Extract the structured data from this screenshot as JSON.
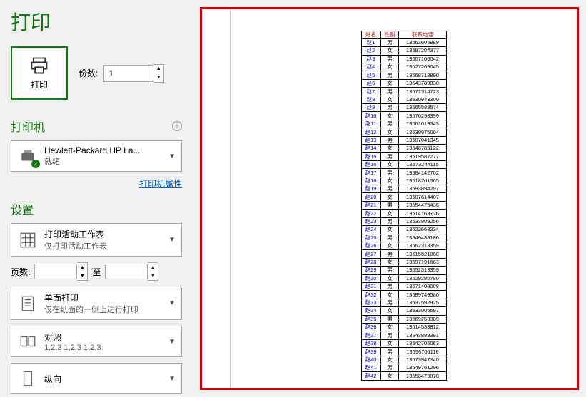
{
  "title": "打印",
  "print_button_label": "打印",
  "copies": {
    "label": "份数:",
    "value": "1"
  },
  "printer": {
    "header": "打印机",
    "name": "Hewlett-Packard HP La...",
    "status": "就绪",
    "properties_link": "打印机属性"
  },
  "settings": {
    "header": "设置",
    "active_sheets": {
      "line1": "打印活动工作表",
      "line2": "仅打印活动工作表"
    },
    "pages": {
      "label": "页数:",
      "to": "至"
    },
    "sides": {
      "line1": "单面打印",
      "line2": "仅在纸面的一侧上进行打印"
    },
    "collate": {
      "line1": "对照",
      "line2": "1,2,3    1,2,3    1,2,3"
    },
    "orientation": {
      "line1": "纵向"
    }
  },
  "chart_data": {
    "type": "table",
    "headers": [
      "姓名",
      "性别",
      "联系电话"
    ],
    "rows": [
      [
        "赵1",
        "男",
        "13563605989"
      ],
      [
        "赵2",
        "女",
        "13597204377"
      ],
      [
        "赵3",
        "男",
        "13507100042"
      ],
      [
        "赵4",
        "女",
        "13527269045"
      ],
      [
        "赵5",
        "男",
        "13568718890"
      ],
      [
        "赵6",
        "女",
        "13543789838"
      ],
      [
        "赵7",
        "男",
        "13571314723"
      ],
      [
        "赵8",
        "女",
        "13530943300"
      ],
      [
        "赵9",
        "男",
        "13565583574"
      ],
      [
        "赵10",
        "女",
        "13570298399"
      ],
      [
        "赵11",
        "男",
        "13561019343"
      ],
      [
        "赵12",
        "女",
        "13530975004"
      ],
      [
        "赵13",
        "男",
        "13507041345"
      ],
      [
        "赵14",
        "女",
        "13548783122"
      ],
      [
        "赵15",
        "男",
        "13519587277"
      ],
      [
        "赵16",
        "女",
        "13573244115"
      ],
      [
        "赵17",
        "男",
        "13584142702"
      ],
      [
        "赵18",
        "女",
        "13518761365"
      ],
      [
        "赵19",
        "男",
        "13593894297"
      ],
      [
        "赵20",
        "女",
        "13507614407"
      ],
      [
        "赵21",
        "男",
        "13554475436"
      ],
      [
        "赵22",
        "女",
        "13514163726"
      ],
      [
        "赵23",
        "男",
        "13533809256"
      ],
      [
        "赵24",
        "女",
        "13522663234"
      ],
      [
        "赵25",
        "男",
        "13549438186"
      ],
      [
        "赵26",
        "女",
        "13562313359"
      ],
      [
        "赵27",
        "男",
        "13515521068"
      ],
      [
        "赵28",
        "女",
        "13597191663"
      ],
      [
        "赵29",
        "男",
        "13552313359"
      ],
      [
        "赵30",
        "女",
        "13529280780"
      ],
      [
        "赵31",
        "男",
        "13571409008"
      ],
      [
        "赵32",
        "女",
        "13589749580"
      ],
      [
        "赵33",
        "男",
        "13537592925"
      ],
      [
        "赵34",
        "女",
        "13533005697"
      ],
      [
        "赵35",
        "男",
        "13569253389"
      ],
      [
        "赵36",
        "女",
        "13514533812"
      ],
      [
        "赵37",
        "男",
        "13543889391"
      ],
      [
        "赵38",
        "女",
        "13542705063"
      ],
      [
        "赵39",
        "男",
        "13596709118"
      ],
      [
        "赵40",
        "女",
        "13573947340"
      ],
      [
        "赵41",
        "男",
        "13549761296"
      ],
      [
        "赵42",
        "女",
        "13558473870"
      ]
    ]
  }
}
